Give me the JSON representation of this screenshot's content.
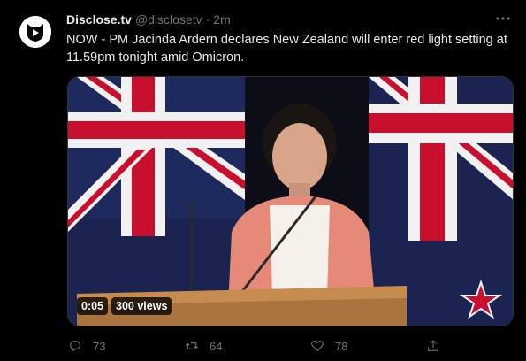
{
  "tweet": {
    "author_name": "Disclose.tv",
    "handle": "@disclosetv",
    "separator": "·",
    "time": "2m",
    "text": "NOW - PM Jacinda Ardern declares New Zealand will enter red light setting at 11.59pm tonight amid Omicron.",
    "avatar_icon": "disclose-tv-logo-icon",
    "more_icon": "more-options-icon"
  },
  "media": {
    "type": "video",
    "duration": "0:05",
    "views": "300 views"
  },
  "actions": {
    "reply_count": "73",
    "retweet_count": "64",
    "like_count": "78",
    "reply_icon": "reply-icon",
    "retweet_icon": "retweet-icon",
    "like_icon": "heart-icon",
    "share_icon": "share-icon"
  },
  "colors": {
    "background": "#000000",
    "text_primary": "#e7e9ea",
    "text_secondary": "#71767b",
    "border": "#2f3336"
  }
}
